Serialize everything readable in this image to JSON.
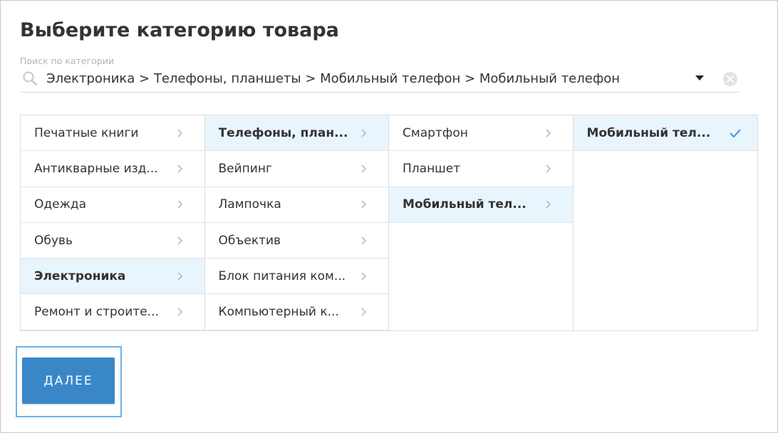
{
  "page": {
    "title": "Выберите категорию товара"
  },
  "search": {
    "label": "Поиск по категории",
    "value": "Электроника > Телефоны, планшеты > Мобильный телефон > Мобильный телефон",
    "icon": "search-icon",
    "dropdown_icon": "chevron-down-icon",
    "clear_icon": "clear-icon"
  },
  "columns": [
    {
      "items": [
        {
          "label": "Печатные книги",
          "selected": false
        },
        {
          "label": "Антикварные изд...",
          "selected": false
        },
        {
          "label": "Одежда",
          "selected": false
        },
        {
          "label": "Обувь",
          "selected": false
        },
        {
          "label": "Электроника",
          "selected": true
        },
        {
          "label": "Ремонт и строите...",
          "selected": false
        }
      ]
    },
    {
      "items": [
        {
          "label": "Телефоны, план...",
          "selected": true
        },
        {
          "label": "Вейпинг",
          "selected": false
        },
        {
          "label": "Лампочка",
          "selected": false
        },
        {
          "label": "Объектив",
          "selected": false
        },
        {
          "label": "Блок питания ком...",
          "selected": false
        },
        {
          "label": "Компьютерный к...",
          "selected": false
        }
      ]
    },
    {
      "items": [
        {
          "label": "Смартфон",
          "selected": false
        },
        {
          "label": "Планшет",
          "selected": false
        },
        {
          "label": "Мобильный тел...",
          "selected": true
        }
      ]
    },
    {
      "items": [
        {
          "label": "Мобильный тел...",
          "selected": true,
          "checked": true
        }
      ]
    }
  ],
  "actions": {
    "next_label": "ДАЛЕЕ"
  },
  "colors": {
    "accent": "#3a87c8",
    "selected_bg": "#e9f5fd",
    "check": "#3a87c8",
    "focus_outline": "#6fb2ea"
  }
}
